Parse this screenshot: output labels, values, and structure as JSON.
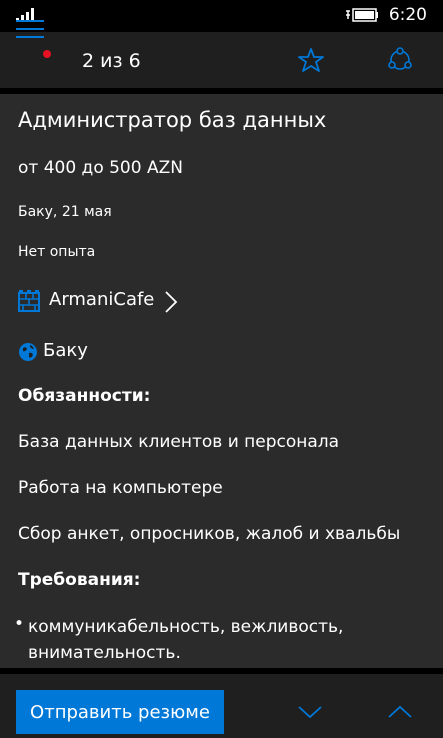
{
  "status": {
    "time": "6:20"
  },
  "header": {
    "counter": "2 из 6"
  },
  "job": {
    "title": "Администратор баз данных",
    "salary": "от 400 до 500 AZN",
    "location_date": "Баку, 21 мая",
    "experience": "Нет опыта",
    "company": "ArmaniCafe",
    "city": "Баку"
  },
  "duties": {
    "heading": "Обязанности:",
    "items": [
      "База данных клиентов и персонала",
      "Работа на компьютере",
      "Сбор анкет, опросников, жалоб и хвальбы"
    ]
  },
  "requirements": {
    "heading": "Требования:",
    "items": [
      "коммуникабельность, вежливость, внимательность."
    ]
  },
  "actions": {
    "send_label": "Отправить резюме"
  },
  "colors": {
    "accent": "#0078d7",
    "notification": "#e81123",
    "background": "#2b2b2b",
    "bar": "#1f1f1f"
  }
}
